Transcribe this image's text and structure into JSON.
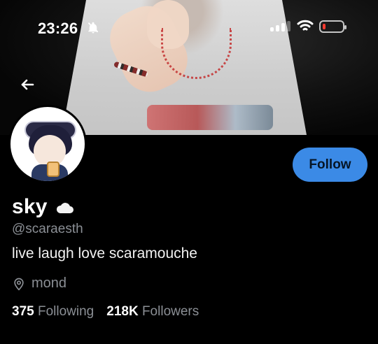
{
  "status_bar": {
    "time": "23:26",
    "icons": [
      "bell-slash-icon",
      "signal-icon",
      "wifi-icon",
      "battery-icon"
    ],
    "battery_level_fraction": 0.15
  },
  "nav": {
    "back_icon": "arrow-left-icon"
  },
  "profile": {
    "display_name": "sky",
    "emoji": "cloud-emoji",
    "handle": "@scaraesth",
    "bio": "live laugh love scaramouche",
    "location_label": "mond",
    "stats": {
      "following_count": "375",
      "following_label": "Following",
      "followers_count": "218K",
      "followers_label": "Followers"
    }
  },
  "actions": {
    "follow_label": "Follow"
  },
  "colors": {
    "background": "#000000",
    "accent": "#3b8ae6",
    "muted_text": "#8b8f95",
    "text": "#ffffff"
  }
}
